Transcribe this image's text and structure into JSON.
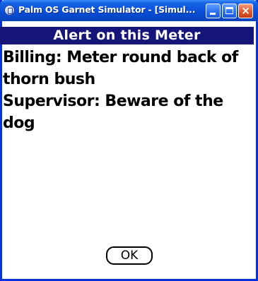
{
  "window": {
    "title": "Palm OS Garnet Simulator - [Simul...",
    "buttons": {
      "minimize": "minimize",
      "maximize": "maximize",
      "close": "×"
    }
  },
  "alert": {
    "title": "Alert on this Meter",
    "lines": [
      "Billing: Meter round back of",
      "thorn bush",
      "Supervisor: Beware of the",
      "dog"
    ],
    "ok_label": "OK"
  },
  "colors": {
    "titlebar_blue": "#0a4fd8",
    "alert_header": "#15157a",
    "close_red": "#e05a2e"
  }
}
